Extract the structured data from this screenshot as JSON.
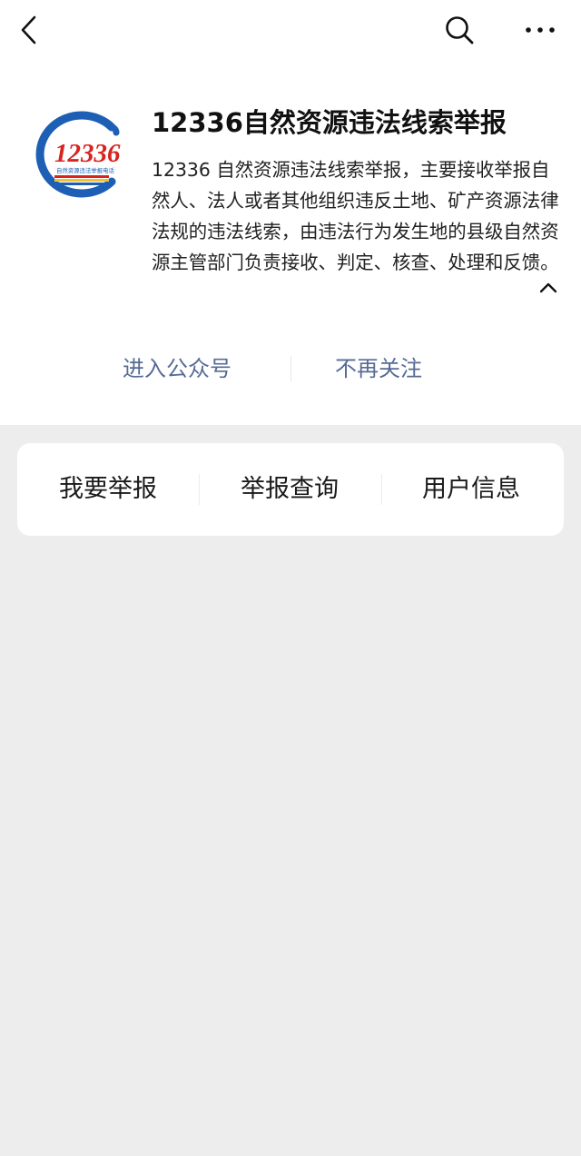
{
  "navbar": {
    "back_icon": "chevron-left-icon",
    "search_icon": "search-icon",
    "more_icon": "more-dots-icon"
  },
  "account": {
    "name": "12336自然资源违法线索举报",
    "logo": {
      "text": "12336",
      "subtext": "自然资源违法举报电话",
      "colors": {
        "ring": "#1d5fb4",
        "number": "#d8231e",
        "stripe_red": "#d8231e",
        "stripe_yellow": "#f2c230",
        "stripe_blue": "#1d5fb4"
      }
    },
    "description": "12336 自然资源违法线索举报，主要接收举报自然人、法人或者其他组织违反土地、矿产资源法律法规的违法线索，由违法行为发生地的县级自然资源主管部门负责接收、判定、核查、处理和反馈。",
    "collapse_icon": "chevron-up-icon"
  },
  "actions": {
    "enter_label": "进入公众号",
    "unfollow_label": "不再关注"
  },
  "menu": {
    "items": [
      {
        "label": "我要举报"
      },
      {
        "label": "举报查询"
      },
      {
        "label": "用户信息"
      }
    ]
  },
  "colors": {
    "link": "#576b95",
    "background": "#ededed",
    "card": "#ffffff"
  }
}
